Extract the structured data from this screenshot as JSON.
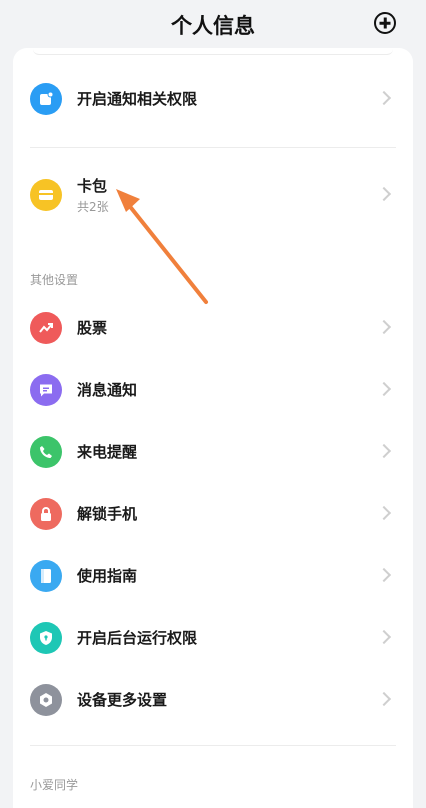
{
  "header": {
    "title": "个人信息"
  },
  "rows_top": [
    {
      "label": "开启通知相关权限",
      "color": "#2a9df4",
      "icon": "notification-icon"
    },
    {
      "label": "卡包",
      "sub": "共2张",
      "color": "#f7c325",
      "icon": "wallet-icon"
    }
  ],
  "sections": {
    "other": "其他设置",
    "xiaoai": "小爱同学"
  },
  "rows_other": [
    {
      "label": "股票",
      "color": "#ef5a5a",
      "icon": "stock-chart-icon"
    },
    {
      "label": "消息通知",
      "color": "#8b6cf0",
      "icon": "message-icon"
    },
    {
      "label": "来电提醒",
      "color": "#3cc46a",
      "icon": "phone-icon"
    },
    {
      "label": "解锁手机",
      "color": "#ee6a5f",
      "icon": "lock-icon"
    },
    {
      "label": "使用指南",
      "color": "#3aa9f1",
      "icon": "guide-icon"
    },
    {
      "label": "开启后台运行权限",
      "color": "#1ec7b5",
      "icon": "shield-icon"
    },
    {
      "label": "设备更多设置",
      "color": "#8e929c",
      "icon": "settings-icon"
    }
  ]
}
